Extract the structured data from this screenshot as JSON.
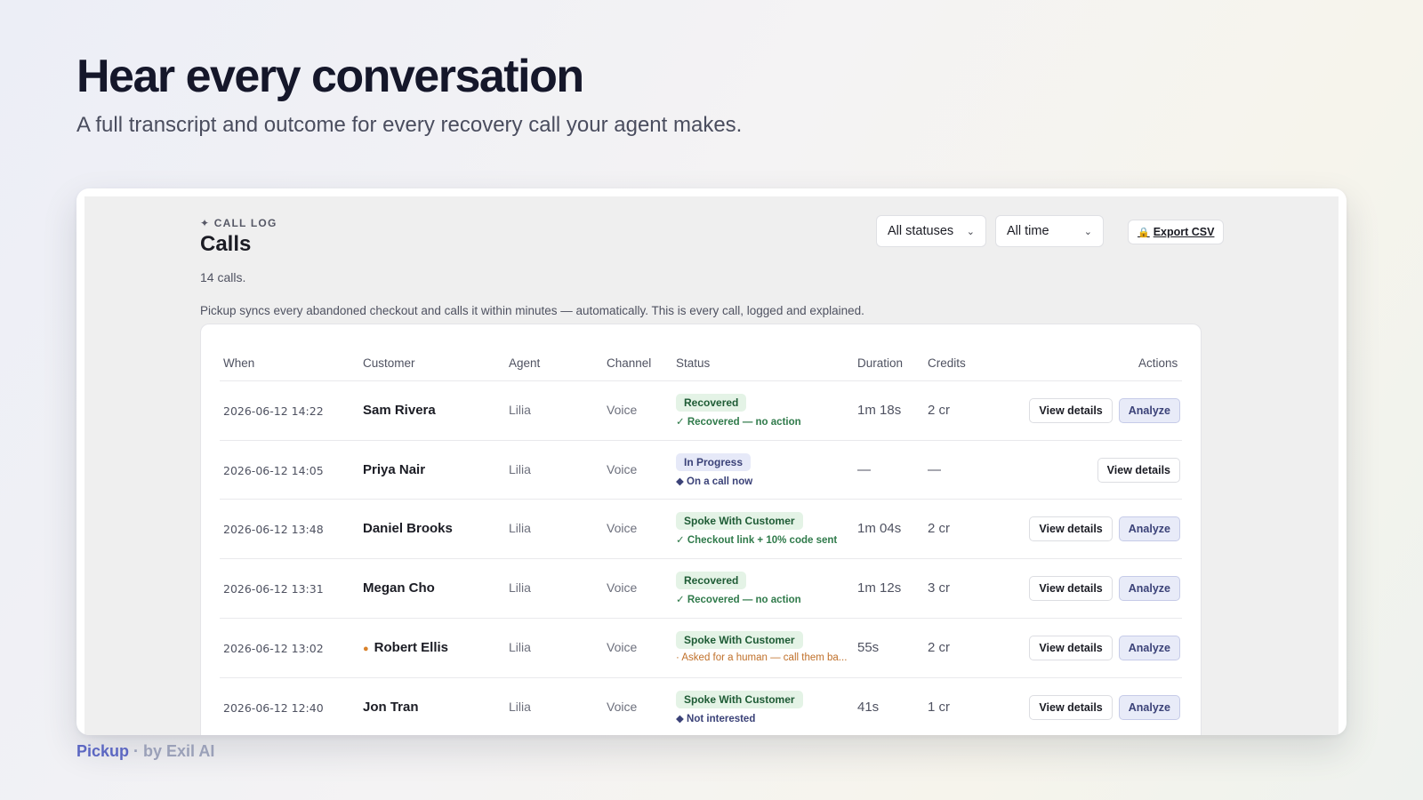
{
  "hero": {
    "title": "Hear every conversation",
    "subtitle": "A full transcript and outcome for every recovery call your agent makes."
  },
  "app": {
    "eyebrow": "✦ CALL LOG",
    "title": "Calls",
    "count": "14 calls.",
    "description": "Pickup syncs every abandoned checkout and calls it within minutes — automatically. This is every call, logged and explained.",
    "filters": {
      "status": "All statuses",
      "time": "All time"
    },
    "export_label": "Export CSV",
    "export_icon": "🔒",
    "columns": {
      "when": "When",
      "customer": "Customer",
      "agent": "Agent",
      "channel": "Channel",
      "status": "Status",
      "duration": "Duration",
      "credits": "Credits",
      "actions": "Actions"
    },
    "action_labels": {
      "view": "View details",
      "analyze": "Analyze"
    },
    "rows": [
      {
        "when": "2026-06-12 14:22",
        "customer": "Sam Rivera",
        "agent": "Lilia",
        "channel": "Voice",
        "status": "Recovered",
        "note": "✓ Recovered — no action",
        "duration": "1m 18s",
        "credits": "2 cr"
      },
      {
        "when": "2026-06-12 14:05",
        "customer": "Priya Nair",
        "agent": "Lilia",
        "channel": "Voice",
        "status": "In Progress",
        "note": "◆ On a call now",
        "duration": "—",
        "credits": "—"
      },
      {
        "when": "2026-06-12 13:48",
        "customer": "Daniel Brooks",
        "agent": "Lilia",
        "channel": "Voice",
        "status": "Spoke With Customer",
        "note": "✓ Checkout link + 10% code sent",
        "duration": "1m 04s",
        "credits": "2 cr"
      },
      {
        "when": "2026-06-12 13:31",
        "customer": "Megan Cho",
        "agent": "Lilia",
        "channel": "Voice",
        "status": "Recovered",
        "note": "✓ Recovered — no action",
        "duration": "1m 12s",
        "credits": "3 cr"
      },
      {
        "when": "2026-06-12 13:02",
        "customer": "Robert Ellis",
        "agent": "Lilia",
        "channel": "Voice",
        "status": "Spoke With Customer",
        "note": "· Asked for a human — call them ba...",
        "duration": "55s",
        "credits": "2 cr"
      },
      {
        "when": "2026-06-12 12:40",
        "customer": "Jon Tran",
        "agent": "Lilia",
        "channel": "Voice",
        "status": "Spoke With Customer",
        "note": "◆ Not interested",
        "duration": "41s",
        "credits": "1 cr"
      }
    ]
  },
  "brand": {
    "name": "Pickup",
    "by": " · by Exil AI"
  },
  "colors": {
    "accent": "#5c67c2",
    "badge_green_bg": "#e4f3e6",
    "badge_blue_bg": "#e6e9f8",
    "note_green": "#2f7a4a",
    "note_orange": "#c0702a"
  }
}
